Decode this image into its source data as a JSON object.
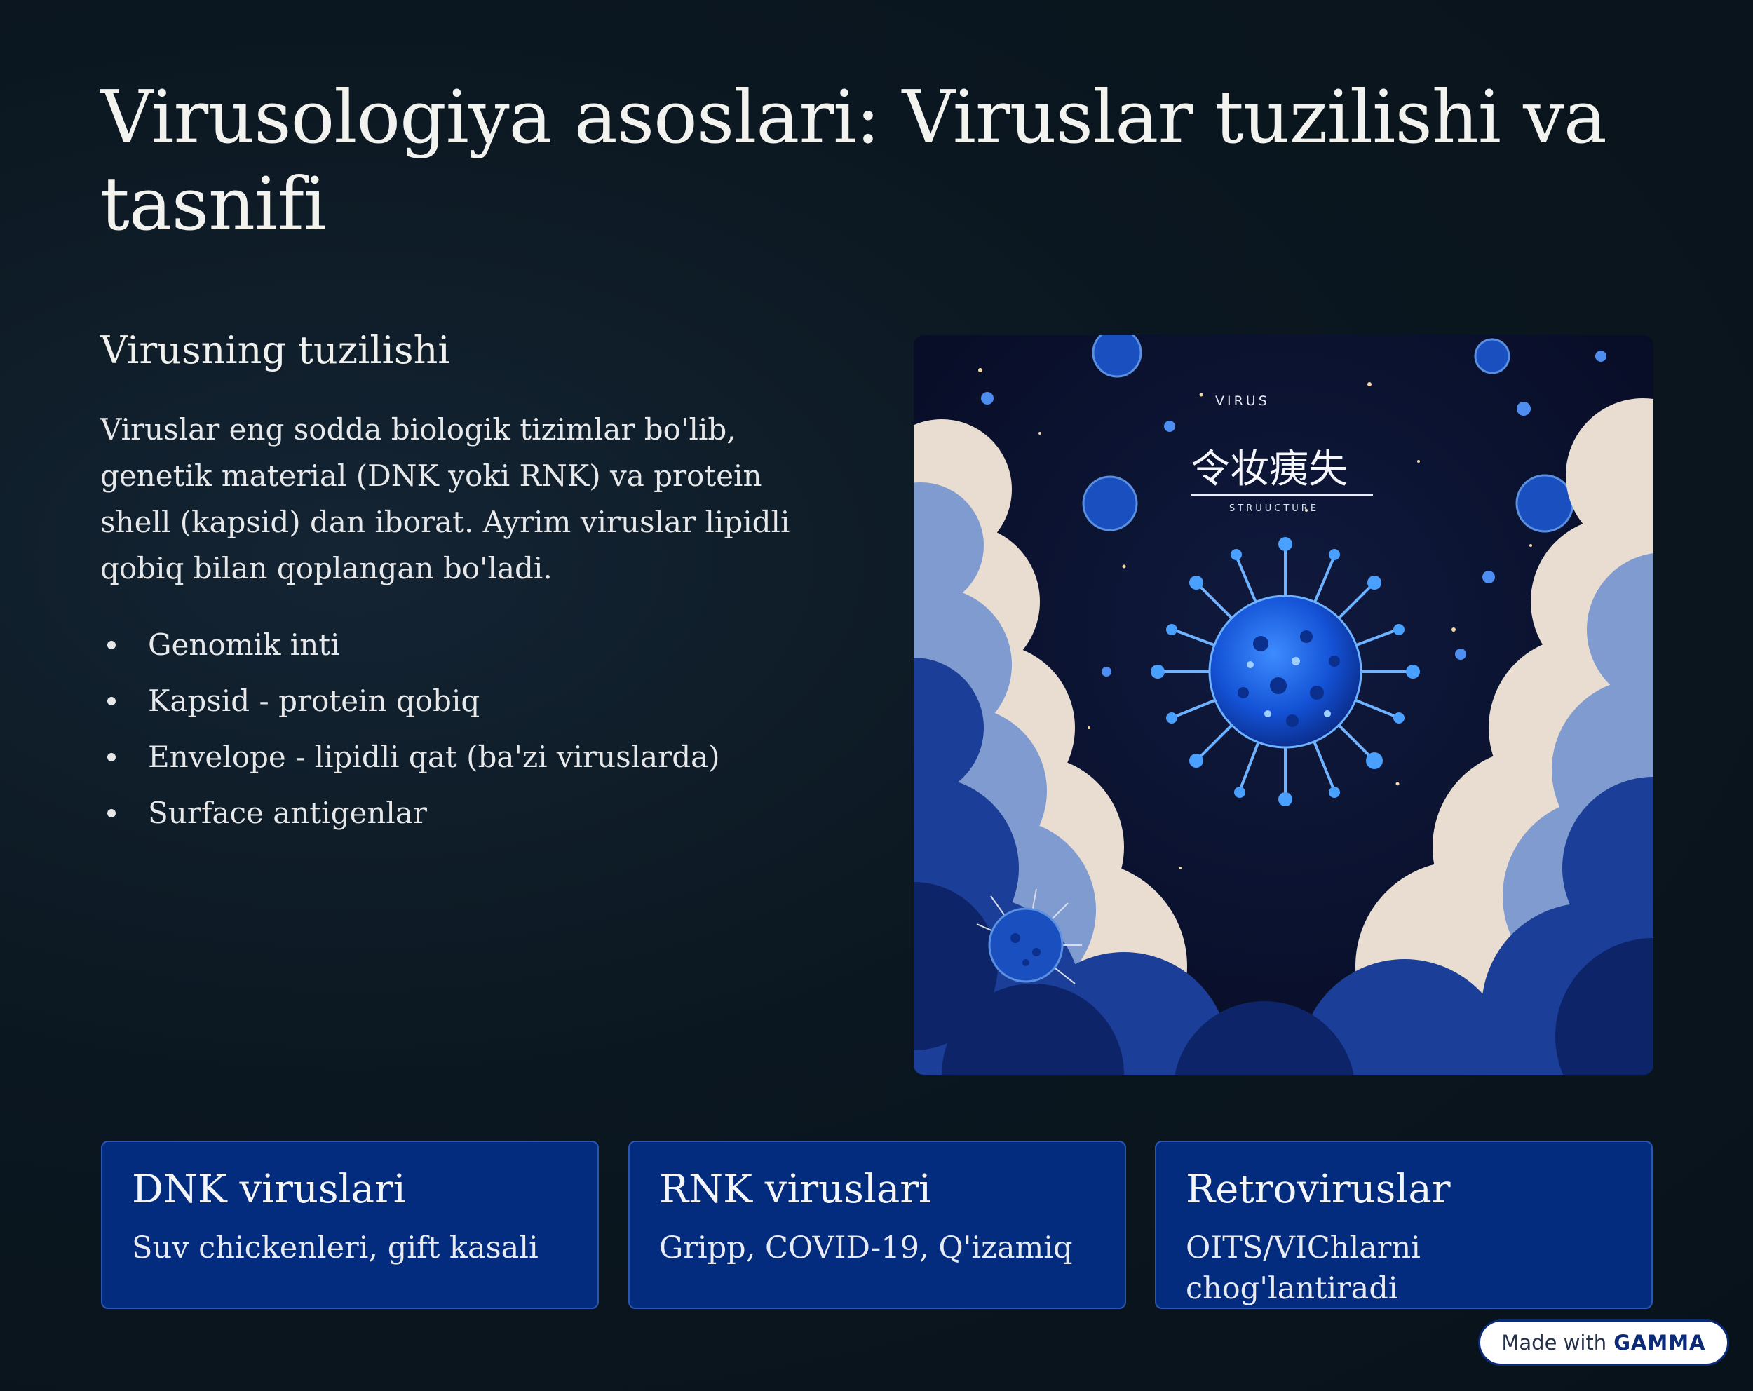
{
  "slide": {
    "title": "Virusologiya asoslari: Viruslar tuzilishi va tasnifi",
    "section_heading": "Virusning tuzilishi",
    "body": "Viruslar eng sodda biologik tizimlar bo'lib, genetik material (DNK yoki RNK) va protein shell (kapsid) dan iborat. Ayrim viruslar lipidli qobiq bilan qoplangan bo'ladi.",
    "bullets": [
      "Genomik inti",
      "Kapsid - protein qobiq",
      "Envelope - lipidli qat (ba'zi viruslarda)",
      "Surface antigenlar"
    ]
  },
  "illustration": {
    "label_top": "VIRUS",
    "label_glyphs": "令妆痍失",
    "label_sub": "STRUUCTURE"
  },
  "cards": [
    {
      "title": "DNK viruslari",
      "text": "Suv chickenleri, gift kasali"
    },
    {
      "title": "RNK viruslari",
      "text": "Gripp, COVID-19, Q'izamiq"
    },
    {
      "title": "Retroviruslar",
      "text": "OITS/VIChlarni chog'lantiradi"
    }
  ],
  "badge": {
    "prefix": "Made with",
    "brand": "GAMMA"
  },
  "colors": {
    "background": "#0b1720",
    "card": "#042c7e",
    "card_border": "#2a56b3"
  }
}
